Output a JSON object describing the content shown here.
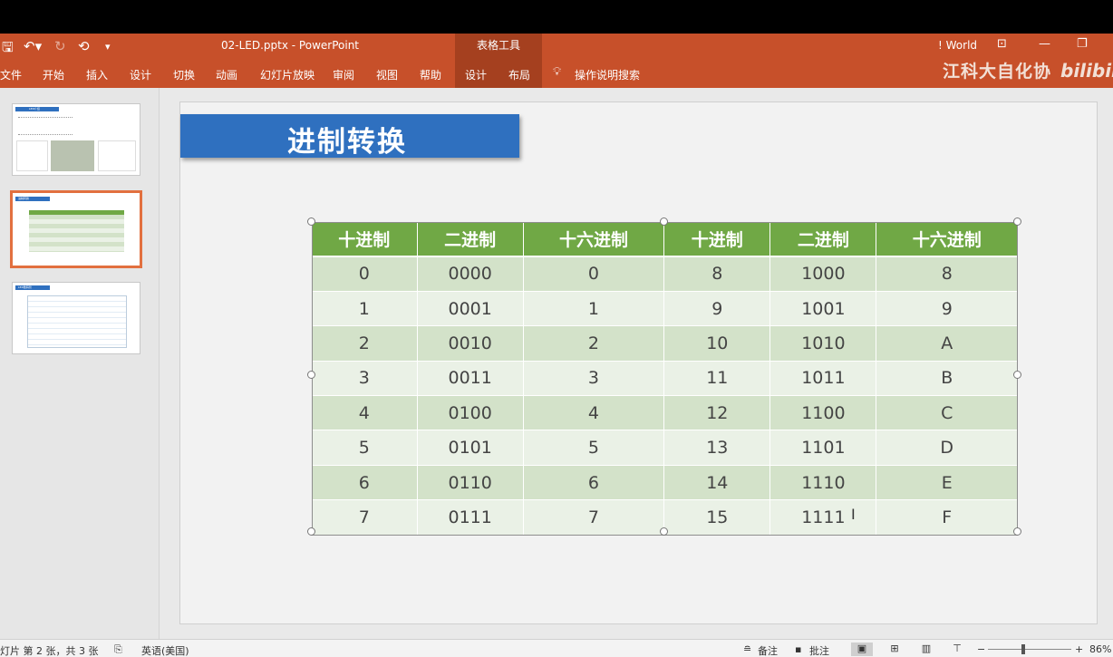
{
  "titlebar": {
    "doc_title": "02-LED.pptx  -  PowerPoint",
    "context_tools": "表格工具",
    "account": "! World",
    "qat": {
      "save_icon": "save-icon",
      "undo_icon": "undo-icon",
      "redo_icon": "redo-icon",
      "start_icon": "start-from-beginning-icon"
    }
  },
  "ribbon": {
    "tabs": [
      "文件",
      "开始",
      "插入",
      "设计",
      "切换",
      "动画",
      "幻灯片放映",
      "审阅",
      "视图",
      "帮助",
      "设计",
      "布局"
    ],
    "search_label": "操作说明搜索"
  },
  "watermark": {
    "text": "江科大自化协",
    "logo": "bilibili"
  },
  "slide": {
    "title": "进制转换",
    "table": {
      "headers": [
        "十进制",
        "二进制",
        "十六进制",
        "十进制",
        "二进制",
        "十六进制"
      ],
      "rows": [
        [
          "0",
          "0000",
          "0",
          "8",
          "1000",
          "8"
        ],
        [
          "1",
          "0001",
          "1",
          "9",
          "1001",
          "9"
        ],
        [
          "2",
          "0010",
          "2",
          "10",
          "1010",
          "A"
        ],
        [
          "3",
          "0011",
          "3",
          "11",
          "1011",
          "B"
        ],
        [
          "4",
          "0100",
          "4",
          "12",
          "1100",
          "C"
        ],
        [
          "5",
          "0101",
          "5",
          "13",
          "1101",
          "D"
        ],
        [
          "6",
          "0110",
          "6",
          "14",
          "1110",
          "E"
        ],
        [
          "7",
          "0111",
          "7",
          "15",
          "1111",
          "F"
        ]
      ]
    }
  },
  "thumbnails": {
    "slide1_title": "LED介绍",
    "slide2_title": "进制转换",
    "slide3_title": "LED数码管"
  },
  "statusbar": {
    "slide_info": "灯片 第 2 张，共 3 张",
    "language": "英语(美国)",
    "notes": "备注",
    "comments": "批注",
    "zoom": "86%"
  },
  "colors": {
    "ribbon": "#c7502a",
    "title_box": "#2f70bf",
    "table_header": "#70a845",
    "row_dark": "#d3e2c9",
    "row_light": "#eaf1e6"
  }
}
